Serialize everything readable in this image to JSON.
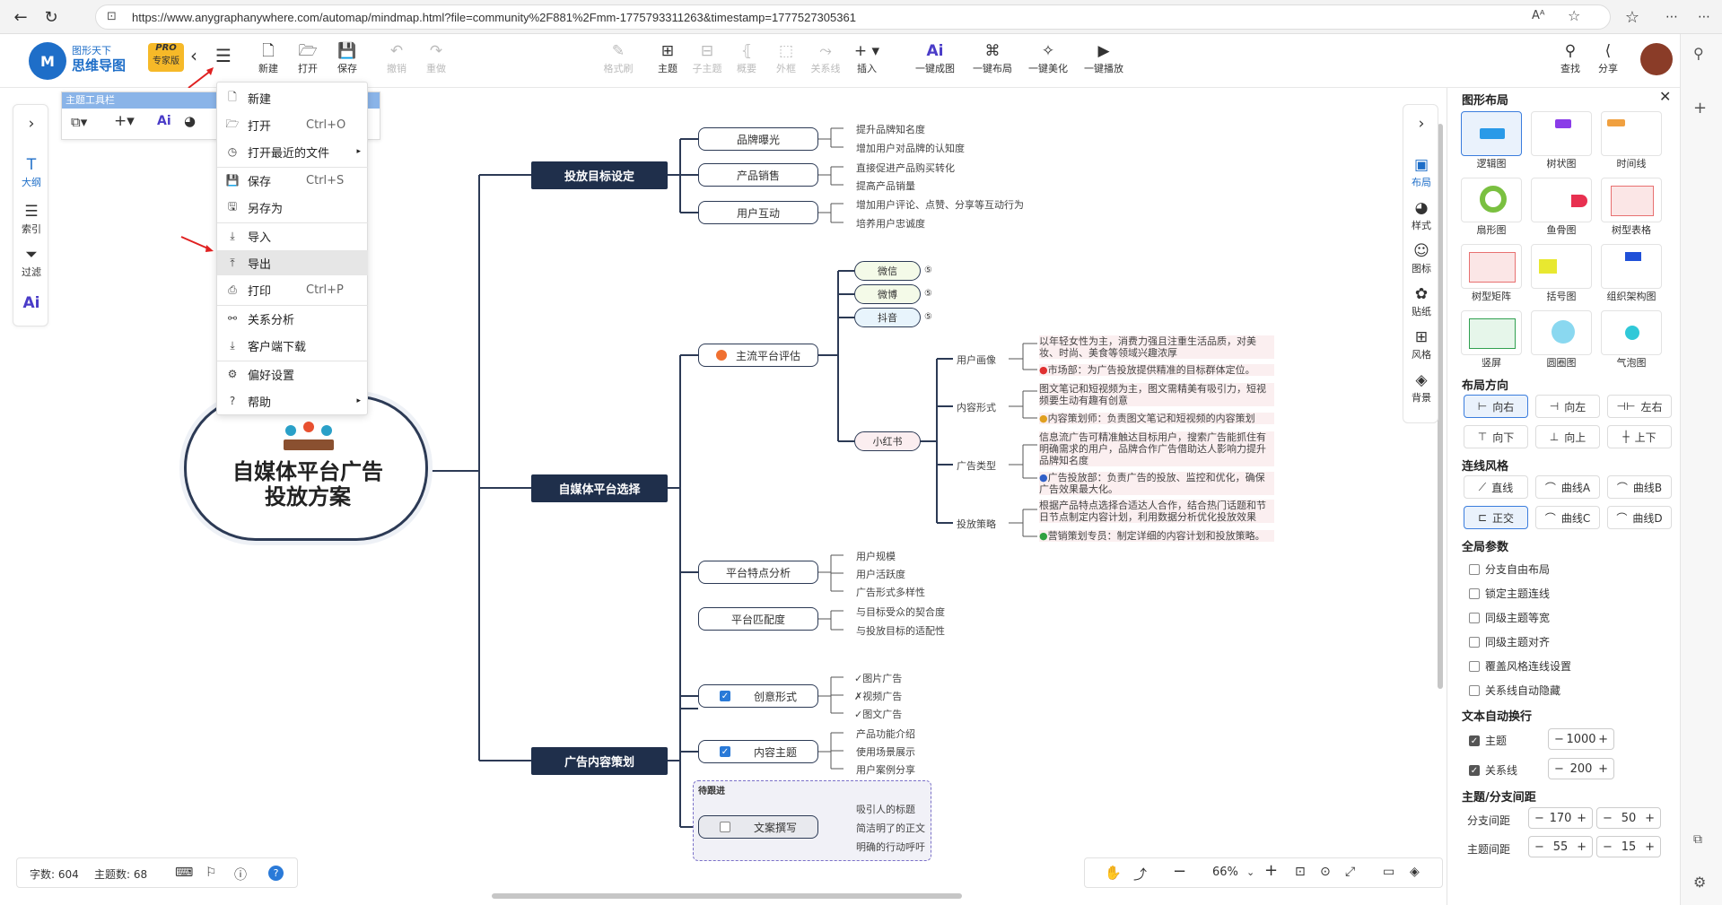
{
  "browser": {
    "url": "https://www.anygraphanywhere.com/automap/mindmap.html?file=community%2F881%2Fmm-1775793311263&timestamp=1777527305361"
  },
  "app": {
    "brand_top": "图形天下",
    "brand_bottom": "思维导图",
    "pro_top": "PRO",
    "pro_bottom": "专家版"
  },
  "toolbar": {
    "new": "新建",
    "open": "打开",
    "save": "保存",
    "undo": "撤销",
    "redo": "重做",
    "format_brush": "格式刷",
    "topic": "主题",
    "subtopic": "子主题",
    "summary": "概要",
    "boundary": "外框",
    "relation": "关系线",
    "insert": "插入",
    "ai_map": "一键成图",
    "ai_layout": "一键布局",
    "ai_beautify": "一键美化",
    "ai_play": "一键播放",
    "search": "查找",
    "share": "分享"
  },
  "left_sidebar": {
    "outline": "大纲",
    "index": "索引",
    "filter": "过滤"
  },
  "topic_toolbar": {
    "title": "主题工具栏"
  },
  "menu": {
    "items": [
      {
        "label": "新建",
        "shortcut": ""
      },
      {
        "label": "打开",
        "shortcut": "Ctrl+O"
      },
      {
        "label": "打开最近的文件",
        "shortcut": ""
      },
      {
        "label": "保存",
        "shortcut": "Ctrl+S"
      },
      {
        "label": "另存为",
        "shortcut": ""
      },
      {
        "label": "导入",
        "shortcut": ""
      },
      {
        "label": "导出",
        "shortcut": ""
      },
      {
        "label": "打印",
        "shortcut": "Ctrl+P"
      },
      {
        "label": "关系分析",
        "shortcut": ""
      },
      {
        "label": "客户端下载",
        "shortcut": ""
      },
      {
        "label": "偏好设置",
        "shortcut": ""
      },
      {
        "label": "帮助",
        "shortcut": ""
      }
    ]
  },
  "mindmap": {
    "root": "自媒体平台广告投放方案",
    "branch1": {
      "title": "投放目标设定",
      "subs": [
        {
          "label": "品牌曝光",
          "leaves": [
            "提升品牌知名度",
            "增加用户对品牌的认知度"
          ]
        },
        {
          "label": "产品销售",
          "leaves": [
            "直接促进产品购买转化",
            "提高产品销量"
          ]
        },
        {
          "label": "用户互动",
          "leaves": [
            "增加用户评论、点赞、分享等互动行为",
            "培养用户忠诚度"
          ]
        }
      ]
    },
    "branch2": {
      "title": "自媒体平台选择",
      "platform_eval": "主流平台评估",
      "pills": [
        "微信",
        "微博",
        "抖音"
      ],
      "xhs": "小红书",
      "xhs_items": [
        {
          "label": "用户画像",
          "note": "以年轻女性为主，消费力强且注重生活品质，对美妆、时尚、美食等领域兴趣浓厚",
          "role": "市场部：为广告投放提供精准的目标群体定位。"
        },
        {
          "label": "内容形式",
          "note": "图文笔记和短视频为主，图文需精美有吸引力，短视频要生动有趣有创意",
          "role": "内容策划师：负责图文笔记和短视频的内容策划"
        },
        {
          "label": "广告类型",
          "note": "信息流广告可精准触达目标用户，搜索广告能抓住有明确需求的用户，品牌合作广告借助达人影响力提升品牌知名度",
          "role": "广告投放部：负责广告的投放、监控和优化，确保广告效果最大化。"
        },
        {
          "label": "投放策略",
          "note": "根据产品特点选择合适达人合作，结合热门话题和节日节点制定内容计划，利用数据分析优化投放效果",
          "role": "营销策划专员：制定详细的内容计划和投放策略。"
        }
      ],
      "features": {
        "label": "平台特点分析",
        "leaves": [
          "用户规模",
          "用户活跃度",
          "广告形式多样性"
        ]
      },
      "match": {
        "label": "平台匹配度",
        "leaves": [
          "与目标受众的契合度",
          "与投放目标的适配性"
        ]
      }
    },
    "branch3": {
      "title": "广告内容策划",
      "creative": {
        "label": "创意形式",
        "leaves": [
          "✓图片广告",
          "✗视频广告",
          "✓图文广告"
        ]
      },
      "content": {
        "label": "内容主题",
        "leaves": [
          "产品功能介绍",
          "使用场景展示",
          "用户案例分享"
        ]
      },
      "pending": "待跟进",
      "writing": {
        "label": "文案撰写",
        "leaves": [
          "吸引人的标题",
          "简洁明了的正文",
          "明确的行动呼吁"
        ]
      }
    }
  },
  "status": {
    "words": "字数: 604",
    "topics": "主题数: 68"
  },
  "zoom": {
    "level": "66%"
  },
  "right_nav": {
    "layout": "布局",
    "style": "样式",
    "icon": "图标",
    "sticker": "贴纸",
    "theme": "风格",
    "background": "背景"
  },
  "panel": {
    "title": "图形布局",
    "layouts": [
      "逻辑图",
      "树状图",
      "时间线",
      "扇形图",
      "鱼骨图",
      "树型表格",
      "树型矩阵",
      "括号图",
      "组织架构图",
      "竖屏",
      "圆圈图",
      "气泡图"
    ],
    "direction_title": "布局方向",
    "directions": [
      "向右",
      "向左",
      "左右",
      "向下",
      "向上",
      "上下"
    ],
    "line_title": "连线风格",
    "lines": [
      "直线",
      "曲线A",
      "曲线B",
      "正交",
      "曲线C",
      "曲线D"
    ],
    "global_title": "全局参数",
    "global_opts": [
      "分支自由布局",
      "锁定主题连线",
      "同级主题等宽",
      "同级主题对齐",
      "覆盖风格连线设置",
      "关系线自动隐藏"
    ],
    "wrap_title": "文本自动换行",
    "wrap_topic": "主题",
    "wrap_topic_val": "1000",
    "wrap_rel": "关系线",
    "wrap_rel_val": "200",
    "spacing_title": "主题/分支间距",
    "branch_spacing": "分支间距",
    "branch_v1": "170",
    "branch_v2": "50",
    "topic_spacing": "主题间距",
    "topic_v1": "55",
    "topic_v2": "15"
  }
}
